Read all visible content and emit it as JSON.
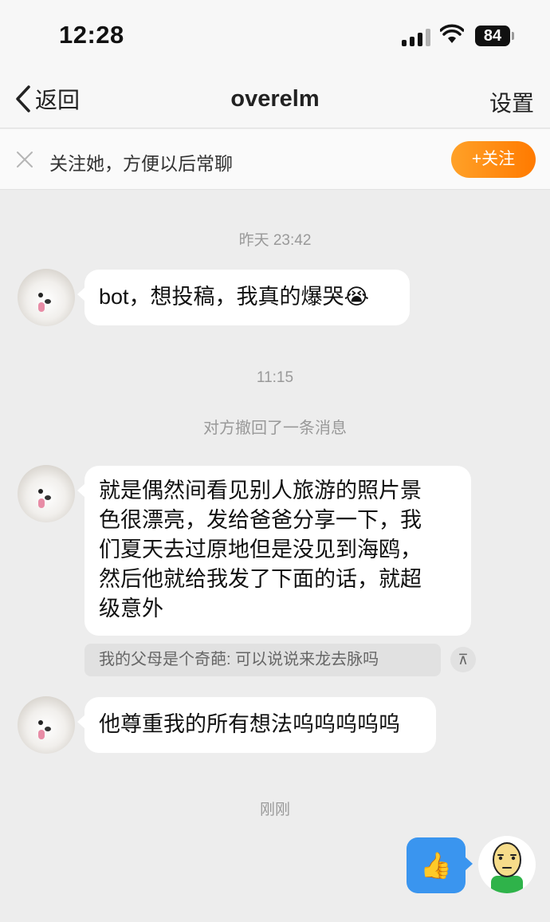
{
  "status_bar": {
    "time": "12:28",
    "battery": "84"
  },
  "nav": {
    "back_label": "返回",
    "title": "overelm",
    "settings_label": "设置"
  },
  "follow_bar": {
    "text": "关注她，方便以后常聊",
    "button_label": "+关注"
  },
  "messages": {
    "ts1": "昨天 23:42",
    "msg1": "bot，想投稿，我真的爆哭😭",
    "ts2": "11:15",
    "recall_note": "对方撤回了一条消息",
    "msg2_lines": [
      "就是偶然间看见别人旅游的照片景",
      "色很漂亮，发给爸爸分享一下，我",
      "们夏天去过原地但是没见到海鸥，",
      "然后他就给我发了下面的话，就超",
      "级意外"
    ],
    "quote": "我的父母是个奇葩: 可以说说来龙去脉吗",
    "quote_toggle": "⊼",
    "msg3": "他尊重我的所有想法呜呜呜呜呜",
    "ts3": "刚刚",
    "my_msg": "👍"
  },
  "colors": {
    "accent_orange": "#ff8a00",
    "my_bubble_blue": "#3a95ef",
    "background": "#ededed"
  }
}
